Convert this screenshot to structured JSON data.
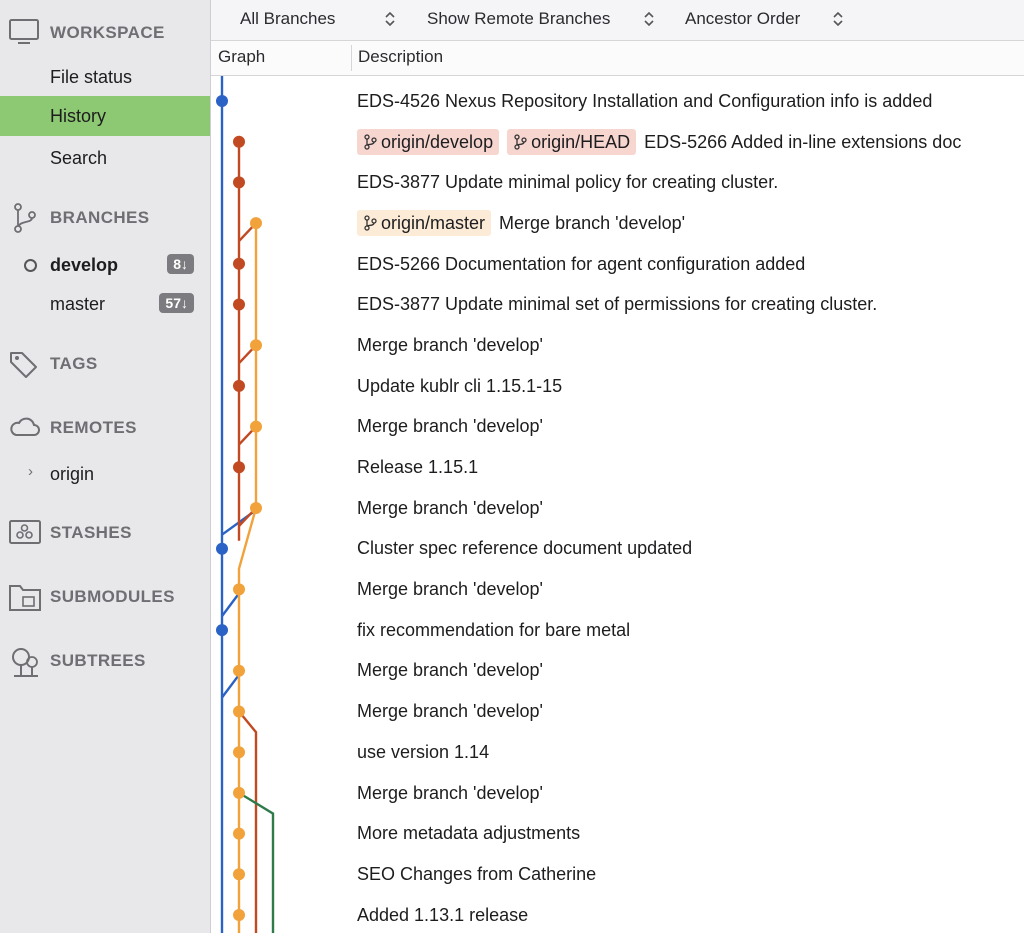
{
  "sidebar": {
    "workspace": {
      "label": "WORKSPACE",
      "items": [
        {
          "label": "File status"
        },
        {
          "label": "History"
        },
        {
          "label": "Search"
        }
      ]
    },
    "branches": {
      "label": "BRANCHES",
      "items": [
        {
          "label": "develop",
          "badge": "8↓",
          "current": true
        },
        {
          "label": "master",
          "badge": "57↓"
        }
      ]
    },
    "tags": {
      "label": "TAGS"
    },
    "remotes": {
      "label": "REMOTES",
      "items": [
        {
          "label": "origin"
        }
      ]
    },
    "stashes": {
      "label": "STASHES"
    },
    "submodules": {
      "label": "SUBMODULES"
    },
    "subtrees": {
      "label": "SUBTREES"
    }
  },
  "toolbar": {
    "branches_filter": "All Branches",
    "remote_filter": "Show Remote Branches",
    "order": "Ancestor Order"
  },
  "columns": {
    "graph": "Graph",
    "description": "Description"
  },
  "colors": {
    "selected": "#8dc872",
    "blue": "#2a63c5",
    "red": "#c24a22",
    "orange": "#f2a23a",
    "green": "#2f7a4a",
    "tag_develop_bg": "#f7d6d0",
    "tag_master_bg": "#fcebd6"
  },
  "commits": [
    {
      "tags": [],
      "message": "EDS-4526 Nexus Repository Installation and Configuration info is added"
    },
    {
      "tags": [
        {
          "label": "origin/develop",
          "style": "red"
        },
        {
          "label": "origin/HEAD",
          "style": "red"
        }
      ],
      "message": "EDS-5266 Added in-line extensions doc"
    },
    {
      "tags": [],
      "message": "EDS-3877 Update minimal policy for creating cluster."
    },
    {
      "tags": [
        {
          "label": "origin/master",
          "style": "orange"
        }
      ],
      "message": "Merge branch 'develop'"
    },
    {
      "tags": [],
      "message": "EDS-5266 Documentation for agent configuration added"
    },
    {
      "tags": [],
      "message": "EDS-3877 Update minimal set of permissions for creating cluster."
    },
    {
      "tags": [],
      "message": "Merge branch 'develop'"
    },
    {
      "tags": [],
      "message": "Update kublr cli  1.15.1-15"
    },
    {
      "tags": [],
      "message": "Merge branch 'develop'"
    },
    {
      "tags": [],
      "message": "Release 1.15.1"
    },
    {
      "tags": [],
      "message": "Merge branch 'develop'"
    },
    {
      "tags": [],
      "message": "Cluster spec reference document updated"
    },
    {
      "tags": [],
      "message": "Merge branch 'develop'"
    },
    {
      "tags": [],
      "message": "fix recommendation for bare metal"
    },
    {
      "tags": [],
      "message": "Merge branch 'develop'"
    },
    {
      "tags": [],
      "message": "Merge branch 'develop'"
    },
    {
      "tags": [],
      "message": "use version 1.14"
    },
    {
      "tags": [],
      "message": "Merge branch 'develop'"
    },
    {
      "tags": [],
      "message": "More metadata adjustments"
    },
    {
      "tags": [],
      "message": "SEO Changes from Catherine"
    },
    {
      "tags": [],
      "message": "Added 1.13.1 release"
    }
  ]
}
